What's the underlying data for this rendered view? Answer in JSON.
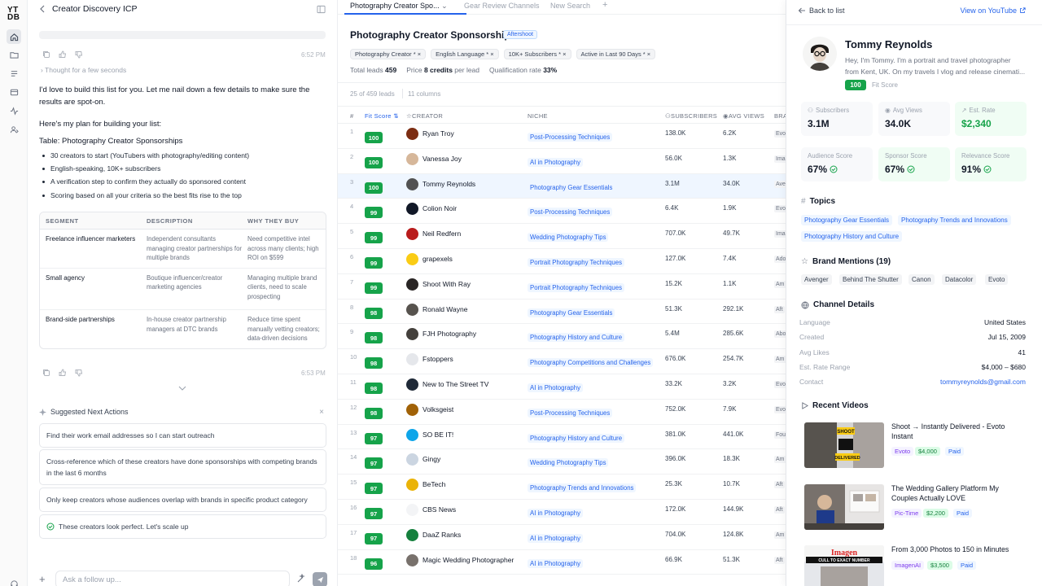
{
  "app": {
    "logo_top": "YT",
    "logo_bottom": "DB"
  },
  "chat": {
    "title": "Creator Discovery ICP",
    "time1": "6:52 PM",
    "thought": "Thought for a few seconds",
    "msg1": "I'd love to build this list for you. Let me nail down a few details to make sure the results are spot-on.",
    "msg2": "Here's my plan for building your list:",
    "msg3": "Table: Photography Creator Sponsorships",
    "bullets": [
      "30 creators to start (YouTubers with photography/editing content)",
      "English-speaking, 10K+ subscribers",
      "A verification step to confirm they actually do sponsored content",
      "Scoring based on all your criteria so the best fits rise to the top"
    ],
    "seg_headers": [
      "SEGMENT",
      "DESCRIPTION",
      "WHY THEY BUY"
    ],
    "seg_rows": [
      {
        "segment": "Freelance influencer marketers",
        "description": "Independent consultants managing creator partnerships for multiple brands",
        "why": "Need competitive intel across many clients; high ROI on $599"
      },
      {
        "segment": "Small agency",
        "description": "Boutique influencer/creator marketing agencies",
        "why": "Managing multiple brand clients, need to scale prospecting"
      },
      {
        "segment": "Brand-side partnerships",
        "description": "In-house creator partnership managers at DTC brands",
        "why": "Reduce time spent manually vetting creators; data-driven decisions"
      }
    ],
    "time2": "6:53 PM",
    "suggest_title": "Suggested Next Actions",
    "suggestions": [
      "Find their work email addresses so I can start outreach",
      "Cross-reference which of these creators have done sponsorships with competing brands in the last 6 months",
      "Only keep creators whose audiences overlap with brands in specific product category",
      "These creators look perfect. Let's scale up"
    ],
    "ask_placeholder": "Ask a follow up..."
  },
  "tabs": [
    "Photography Creator Spo...",
    "Gear Review Channels",
    "New Search"
  ],
  "list": {
    "title": "Photography Creator Sponsorships",
    "badge": "Aftershoot",
    "filters": [
      "Photography Creator * ×",
      "English Language * ×",
      "10K+ Subscribers * ×",
      "Active in Last 90 Days * ×"
    ],
    "total_label": "Total leads",
    "total_value": "459",
    "price_label": "Price",
    "price_value": "8 credits",
    "price_suffix": "per lead",
    "qual_label": "Qualification rate",
    "qual_value": "33%",
    "leads_count": "25 of 459 leads",
    "columns_count": "11 columns"
  },
  "table": {
    "headers": {
      "num": "#",
      "fit": "Fit Score",
      "creator": "CREATOR",
      "niche": "NICHE",
      "subs": "SUBSCRIBERS",
      "views": "AVG VIEWS",
      "brand": "BRA"
    },
    "rows": [
      {
        "n": "1",
        "score": "100",
        "name": "Ryan Troy",
        "niche": "Post-Processing Techniques",
        "subs": "138.0K",
        "views": "6.2K",
        "brand": "Evo",
        "color": "#7c2d12"
      },
      {
        "n": "2",
        "score": "100",
        "name": "Vanessa Joy",
        "niche": "AI in Photography",
        "subs": "56.0K",
        "views": "1.3K",
        "brand": "Ima",
        "color": "#d6b79a"
      },
      {
        "n": "3",
        "score": "100",
        "name": "Tommy Reynolds",
        "niche": "Photography Gear Essentials",
        "subs": "3.1M",
        "views": "34.0K",
        "brand": "Ave",
        "color": "#525252"
      },
      {
        "n": "4",
        "score": "99",
        "name": "Colion Noir",
        "niche": "Post-Processing Techniques",
        "subs": "6.4K",
        "views": "1.9K",
        "brand": "Evo",
        "color": "#111827"
      },
      {
        "n": "5",
        "score": "99",
        "name": "Neil Redfern",
        "niche": "Wedding Photography Tips",
        "subs": "707.0K",
        "views": "49.7K",
        "brand": "Ima",
        "color": "#b91c1c"
      },
      {
        "n": "6",
        "score": "99",
        "name": "grapexels",
        "niche": "Portrait Photography Techniques",
        "subs": "127.0K",
        "views": "7.4K",
        "brand": "Ado",
        "color": "#facc15"
      },
      {
        "n": "7",
        "score": "99",
        "name": "Shoot With Ray",
        "niche": "Portrait Photography Techniques",
        "subs": "15.2K",
        "views": "1.1K",
        "brand": "Am",
        "color": "#292524"
      },
      {
        "n": "8",
        "score": "98",
        "name": "Ronald Wayne",
        "niche": "Photography Gear Essentials",
        "subs": "51.3K",
        "views": "292.1K",
        "brand": "Aft",
        "color": "#57534e"
      },
      {
        "n": "9",
        "score": "98",
        "name": "FJH Photography",
        "niche": "Photography History and Culture",
        "subs": "5.4M",
        "views": "285.6K",
        "brand": "Abo",
        "color": "#44403c"
      },
      {
        "n": "10",
        "score": "98",
        "name": "Fstoppers",
        "niche": "Photography Competitions and Challenges",
        "subs": "676.0K",
        "views": "254.7K",
        "brand": "Am",
        "color": "#e5e7eb"
      },
      {
        "n": "11",
        "score": "98",
        "name": "New to The Street TV",
        "niche": "AI in Photography",
        "subs": "33.2K",
        "views": "3.2K",
        "brand": "Evo",
        "color": "#1f2937"
      },
      {
        "n": "12",
        "score": "98",
        "name": "Volksgeist",
        "niche": "Post-Processing Techniques",
        "subs": "752.0K",
        "views": "7.9K",
        "brand": "Evo",
        "color": "#a16207"
      },
      {
        "n": "13",
        "score": "97",
        "name": "SO BE IT!",
        "niche": "Photography History and Culture",
        "subs": "381.0K",
        "views": "441.0K",
        "brand": "Fou",
        "color": "#0ea5e9"
      },
      {
        "n": "14",
        "score": "97",
        "name": "Gingy",
        "niche": "Wedding Photography Tips",
        "subs": "396.0K",
        "views": "18.3K",
        "brand": "Am",
        "color": "#cbd5e1"
      },
      {
        "n": "15",
        "score": "97",
        "name": "BeTech",
        "niche": "Photography Trends and Innovations",
        "subs": "25.3K",
        "views": "10.7K",
        "brand": "Aft",
        "color": "#eab308"
      },
      {
        "n": "16",
        "score": "97",
        "name": "CBS News",
        "niche": "AI in Photography",
        "subs": "172.0K",
        "views": "144.9K",
        "brand": "Aft",
        "color": "#f3f4f6"
      },
      {
        "n": "17",
        "score": "97",
        "name": "DaaZ Ranks",
        "niche": "AI in Photography",
        "subs": "704.0K",
        "views": "124.8K",
        "brand": "Am",
        "color": "#15803d"
      },
      {
        "n": "18",
        "score": "96",
        "name": "Magic Wedding Photographer",
        "niche": "AI in Photography",
        "subs": "66.9K",
        "views": "51.3K",
        "brand": "Aft",
        "color": "#78716c"
      }
    ]
  },
  "detail": {
    "back": "Back to list",
    "yt_link": "View on YouTube",
    "name": "Tommy Reynolds",
    "bio1": "Hey, I'm Tommy. I'm a portrait and travel photographer",
    "bio2": "from Kent, UK. On my travels I vlog and release cinemati...",
    "fit_score": "100",
    "fit_label": "Fit Score",
    "cards": [
      {
        "label": "Subscribers",
        "value": "3.1M"
      },
      {
        "label": "Avg Views",
        "value": "34.0K"
      },
      {
        "label": "Est. Rate",
        "value": "$2,340"
      },
      {
        "label": "Audience Score",
        "value": "67%"
      },
      {
        "label": "Sponsor Score",
        "value": "67%"
      },
      {
        "label": "Relevance Score",
        "value": "91%"
      }
    ],
    "topics_title": "Topics",
    "topics": [
      "Photography Gear Essentials",
      "Photography Trends and Innovations",
      "Photography History and Culture"
    ],
    "mentions_title": "Brand Mentions (19)",
    "mentions": [
      "Avenger",
      "Behind The Shutter",
      "Canon",
      "Datacolor",
      "Evoto"
    ],
    "channel_title": "Channel Details",
    "channel": [
      {
        "k": "Language",
        "v": "United States"
      },
      {
        "k": "Created",
        "v": "Jul 15, 2009"
      },
      {
        "k": "Avg Likes",
        "v": "41"
      },
      {
        "k": "Est. Rate Range",
        "v": "$4,000 – $680"
      },
      {
        "k": "Contact",
        "v": "tommyreynolds@gmail.com"
      }
    ],
    "videos_title": "Recent Videos",
    "videos": [
      {
        "title": "Shoot → Instantly Delivered - Evoto Instant",
        "brand": "Evoto",
        "price": "$4,000",
        "tag": "Paid"
      },
      {
        "title": "The Wedding Gallery Platform My Couples Actually LOVE",
        "brand": "Pic-Time",
        "price": "$2,200",
        "tag": "Paid"
      },
      {
        "title": "From 3,000 Photos to 150 in Minutes",
        "brand": "ImagenAI",
        "price": "$3,500",
        "tag": "Paid"
      }
    ],
    "thumb_texts": [
      "SHOOT",
      "DELIVERED",
      "Imagen",
      "CULL TO EXACT NUMBER"
    ]
  }
}
